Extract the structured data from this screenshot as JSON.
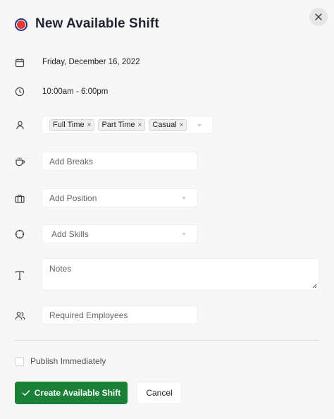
{
  "header": {
    "title": "New Available Shift",
    "brand_color": "#e53935",
    "icons": {
      "brand": "status-dot-icon",
      "close": "close-icon"
    }
  },
  "date": {
    "value": "Friday, December 16, 2022",
    "icon": "calendar-icon"
  },
  "time": {
    "value": "10:00am - 6:00pm",
    "icon": "clock-icon"
  },
  "employment_types": {
    "icon": "person-icon",
    "tags": [
      "Full Time",
      "Part Time",
      "Casual"
    ],
    "remove_symbol": "×"
  },
  "breaks": {
    "placeholder": "Add Breaks",
    "icon": "coffee-cup-icon"
  },
  "position": {
    "placeholder": "Add Position",
    "icon": "briefcase-icon"
  },
  "skills": {
    "placeholder": "Add Skills",
    "icon": "crosshair-icon"
  },
  "notes": {
    "placeholder": "Notes",
    "icon": "text-icon"
  },
  "required_employees": {
    "placeholder": "Required Employees",
    "icon": "people-icon"
  },
  "publish": {
    "label": "Publish Immediately",
    "checked": false
  },
  "actions": {
    "create_label": "Create Available Shift",
    "cancel_label": "Cancel",
    "primary_color": "#1a7f37",
    "icons": {
      "create": "checkmark-icon"
    }
  }
}
